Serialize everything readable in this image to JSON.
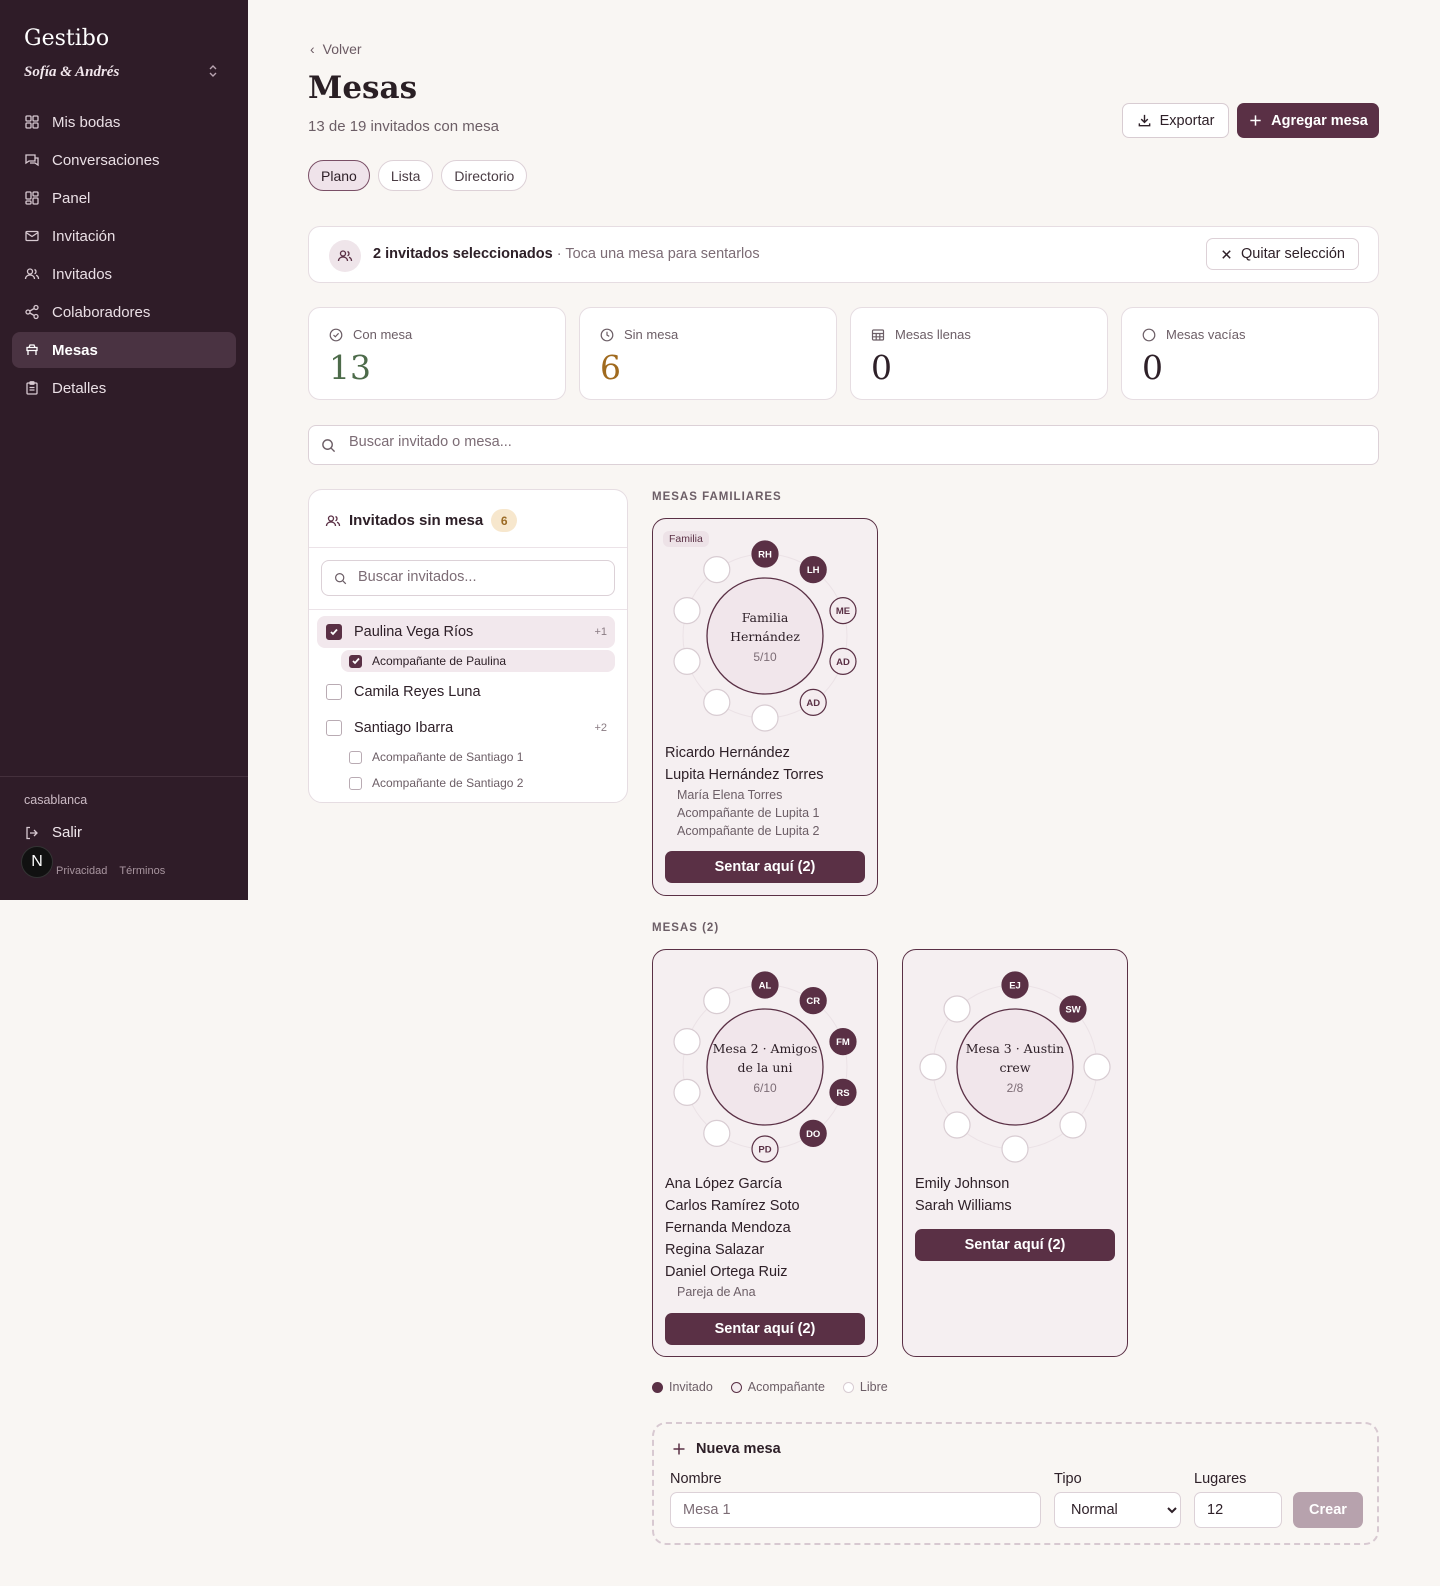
{
  "sidebar": {
    "brand": "Gestibo",
    "wedding": "Sofía & Andrés",
    "items": [
      {
        "label": "Mis bodas",
        "icon": "grid-icon"
      },
      {
        "label": "Conversaciones",
        "icon": "chat-icon"
      },
      {
        "label": "Panel",
        "icon": "dashboard-icon"
      },
      {
        "label": "Invitación",
        "icon": "mail-icon"
      },
      {
        "label": "Invitados",
        "icon": "users-icon"
      },
      {
        "label": "Colaboradores",
        "icon": "share-icon"
      },
      {
        "label": "Mesas",
        "icon": "table-icon"
      },
      {
        "label": "Detalles",
        "icon": "clipboard-icon"
      }
    ],
    "active": "Mesas",
    "user": "casablanca",
    "logout": "Salir",
    "privacy": "Privacidad",
    "terms": "Términos",
    "badge": "N"
  },
  "header": {
    "back": "Volver",
    "title": "Mesas",
    "subtitle": "13 de 19 invitados con mesa",
    "export": "Exportar",
    "add": "Agregar mesa"
  },
  "tabs": [
    "Plano",
    "Lista",
    "Directorio"
  ],
  "selection": {
    "count_text": "2 invitados seleccionados",
    "hint": " · Toca una mesa para sentarlos",
    "clear": "Quitar selección"
  },
  "stats": [
    {
      "label": "Con mesa",
      "value": "13",
      "color": "#4d6b4a",
      "icon": "check-circle-icon"
    },
    {
      "label": "Sin mesa",
      "value": "6",
      "color": "#a06a1e",
      "icon": "clock-icon"
    },
    {
      "label": "Mesas llenas",
      "value": "0",
      "color": "#2e2028",
      "icon": "table-grid-icon"
    },
    {
      "label": "Mesas vacías",
      "value": "0",
      "color": "#2e2028",
      "icon": "circle-icon"
    }
  ],
  "search": {
    "placeholder": "Buscar invitado o mesa..."
  },
  "unseated": {
    "title": "Invitados sin mesa",
    "count": "6",
    "search_placeholder": "Buscar invitados...",
    "guests": [
      {
        "name": "Paulina Vega Ríos",
        "plus": "+1",
        "checked": true,
        "companions": [
          {
            "name": "Acompañante de Paulina",
            "checked": true
          }
        ]
      },
      {
        "name": "Camila Reyes Luna",
        "plus": "",
        "checked": false,
        "companions": []
      },
      {
        "name": "Santiago Ibarra",
        "plus": "+2",
        "checked": false,
        "companions": [
          {
            "name": "Acompañante de Santiago 1",
            "checked": false
          },
          {
            "name": "Acompañante de Santiago 2",
            "checked": false
          }
        ]
      }
    ]
  },
  "sections": {
    "family": "MESAS FAMILIARES",
    "tables": "MESAS (2)"
  },
  "tables": [
    {
      "tag": "Familia",
      "name_lines": [
        "Familia",
        "Hernández"
      ],
      "occupancy": "5/10",
      "capacity": 10,
      "seats": [
        {
          "initials": "RH",
          "kind": "guest"
        },
        {
          "initials": "LH",
          "kind": "guest"
        },
        {
          "initials": "ME",
          "kind": "companion"
        },
        {
          "initials": "AD",
          "kind": "companion"
        },
        {
          "initials": "AD",
          "kind": "companion"
        },
        {
          "initials": "",
          "kind": "free"
        },
        {
          "initials": "",
          "kind": "free"
        },
        {
          "initials": "",
          "kind": "free"
        },
        {
          "initials": "",
          "kind": "free"
        },
        {
          "initials": "",
          "kind": "free"
        }
      ],
      "guests": [
        {
          "name": "Ricardo Hernández",
          "companions": []
        },
        {
          "name": "Lupita Hernández Torres",
          "companions": [
            "María Elena Torres",
            "Acompañante de Lupita 1",
            "Acompañante de Lupita 2"
          ]
        }
      ],
      "button": "Sentar aquí (2)"
    },
    {
      "tag": "",
      "name_lines": [
        "Mesa 2 · Amigos",
        "de la uni"
      ],
      "occupancy": "6/10",
      "capacity": 10,
      "seats": [
        {
          "initials": "AL",
          "kind": "guest"
        },
        {
          "initials": "CR",
          "kind": "guest"
        },
        {
          "initials": "FM",
          "kind": "guest"
        },
        {
          "initials": "RS",
          "kind": "guest"
        },
        {
          "initials": "DO",
          "kind": "guest"
        },
        {
          "initials": "PD",
          "kind": "companion"
        },
        {
          "initials": "",
          "kind": "free"
        },
        {
          "initials": "",
          "kind": "free"
        },
        {
          "initials": "",
          "kind": "free"
        },
        {
          "initials": "",
          "kind": "free"
        }
      ],
      "guests": [
        {
          "name": "Ana López García",
          "companions": []
        },
        {
          "name": "Carlos Ramírez Soto",
          "companions": []
        },
        {
          "name": "Fernanda Mendoza",
          "companions": []
        },
        {
          "name": "Regina Salazar",
          "companions": []
        },
        {
          "name": "Daniel Ortega Ruiz",
          "companions": [
            "Pareja de Ana"
          ]
        }
      ],
      "button": "Sentar aquí (2)"
    },
    {
      "tag": "",
      "name_lines": [
        "Mesa 3 · Austin",
        "crew"
      ],
      "occupancy": "2/8",
      "capacity": 8,
      "seats": [
        {
          "initials": "EJ",
          "kind": "guest"
        },
        {
          "initials": "SW",
          "kind": "guest"
        },
        {
          "initials": "",
          "kind": "free"
        },
        {
          "initials": "",
          "kind": "free"
        },
        {
          "initials": "",
          "kind": "free"
        },
        {
          "initials": "",
          "kind": "free"
        },
        {
          "initials": "",
          "kind": "free"
        },
        {
          "initials": "",
          "kind": "free"
        }
      ],
      "guests": [
        {
          "name": "Emily Johnson",
          "companions": []
        },
        {
          "name": "Sarah Williams",
          "companions": []
        }
      ],
      "button": "Sentar aquí (2)"
    }
  ],
  "legend": [
    {
      "label": "Invitado",
      "kind": "guest"
    },
    {
      "label": "Acompañante",
      "kind": "companion"
    },
    {
      "label": "Libre",
      "kind": "free"
    }
  ],
  "new_table": {
    "title": "Nueva mesa",
    "name_label": "Nombre",
    "name_placeholder": "Mesa 1",
    "type_label": "Tipo",
    "type_value": "Normal",
    "seats_label": "Lugares",
    "seats_value": "12",
    "create": "Crear"
  },
  "colors": {
    "accent": "#5a3045",
    "sidebar": "#2f1c28",
    "background": "#f9f6f3"
  }
}
